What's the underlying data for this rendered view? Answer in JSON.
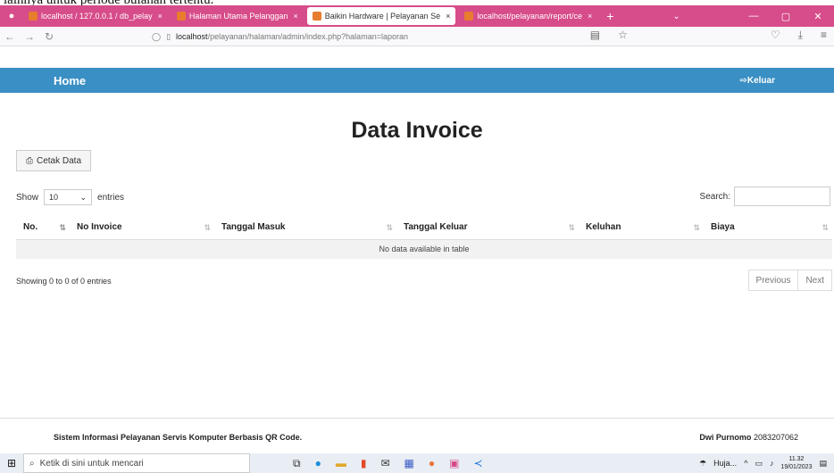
{
  "caption": "lainnya untuk periode bulanan tertentu.",
  "browser": {
    "tabs": [
      {
        "label": "localhost / 127.0.0.1 / db_pelay",
        "active": false
      },
      {
        "label": "Halaman Utama Pelanggan",
        "active": false
      },
      {
        "label": "Baikin Hardware | Pelayanan Se",
        "active": true
      },
      {
        "label": "localhost/pelayanan/report/ce",
        "active": false
      }
    ],
    "new_tab": "+",
    "url_host": "localhost",
    "url_path": "/pelayanan/halaman/admin/index.php?halaman=laporan"
  },
  "app": {
    "home_label": "Home",
    "logout_label": "Keluar",
    "page_title": "Data Invoice",
    "print_label": "Cetak Data",
    "show_label": "Show",
    "entries_value": "10",
    "entries_label": "entries",
    "search_label": "Search:",
    "columns": [
      "No.",
      "No Invoice",
      "Tanggal Masuk",
      "Tanggal Keluar",
      "Keluhan",
      "Biaya"
    ],
    "empty_message": "No data available in table",
    "info_text": "Showing 0 to 0 of 0 entries",
    "prev_label": "Previous",
    "next_label": "Next"
  },
  "footer": {
    "left_text": "Sistem Informasi Pelayanan Servis Komputer Berbasis QR Code.",
    "author_name": "Dwi Purnomo",
    "author_id": "2083207062"
  },
  "taskbar": {
    "search_placeholder": "Ketik di sini untuk mencari",
    "weather": "Huja...",
    "time": "11.32",
    "date": "19/01/2023"
  },
  "colors": {
    "header": "#3a8fc4",
    "tabstrip": "#d74c8a"
  }
}
